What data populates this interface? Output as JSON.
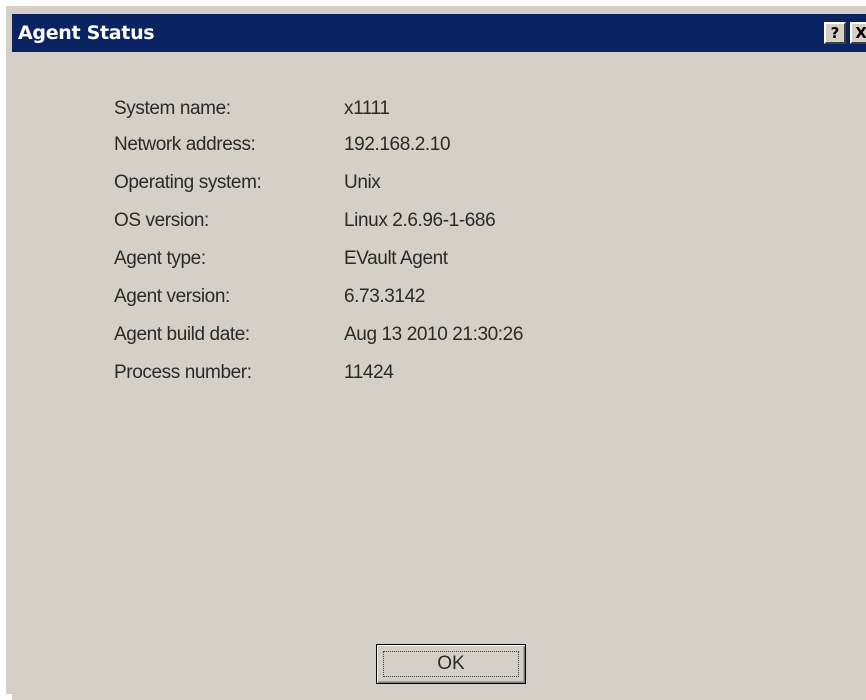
{
  "window": {
    "title": "Agent Status",
    "help_button": "?",
    "close_button": "X"
  },
  "fields": [
    {
      "label": "System name:",
      "value": "x1111"
    },
    {
      "label": "Network address:",
      "value": "192.168.2.10"
    },
    {
      "label": "Operating system:",
      "value": "Unix"
    },
    {
      "label": "OS version:",
      "value": "Linux 2.6.96-1-686"
    },
    {
      "label": "Agent type:",
      "value": "EVault Agent"
    },
    {
      "label": "Agent version:",
      "value": "6.73.3142"
    },
    {
      "label": "Agent build date:",
      "value": "Aug 13 2010 21:30:26"
    },
    {
      "label": "Process number:",
      "value": "11424"
    }
  ],
  "buttons": {
    "ok_label": "OK"
  },
  "colors": {
    "titlebar": "#0a2463",
    "dialog_face": "#d4d0c8"
  }
}
